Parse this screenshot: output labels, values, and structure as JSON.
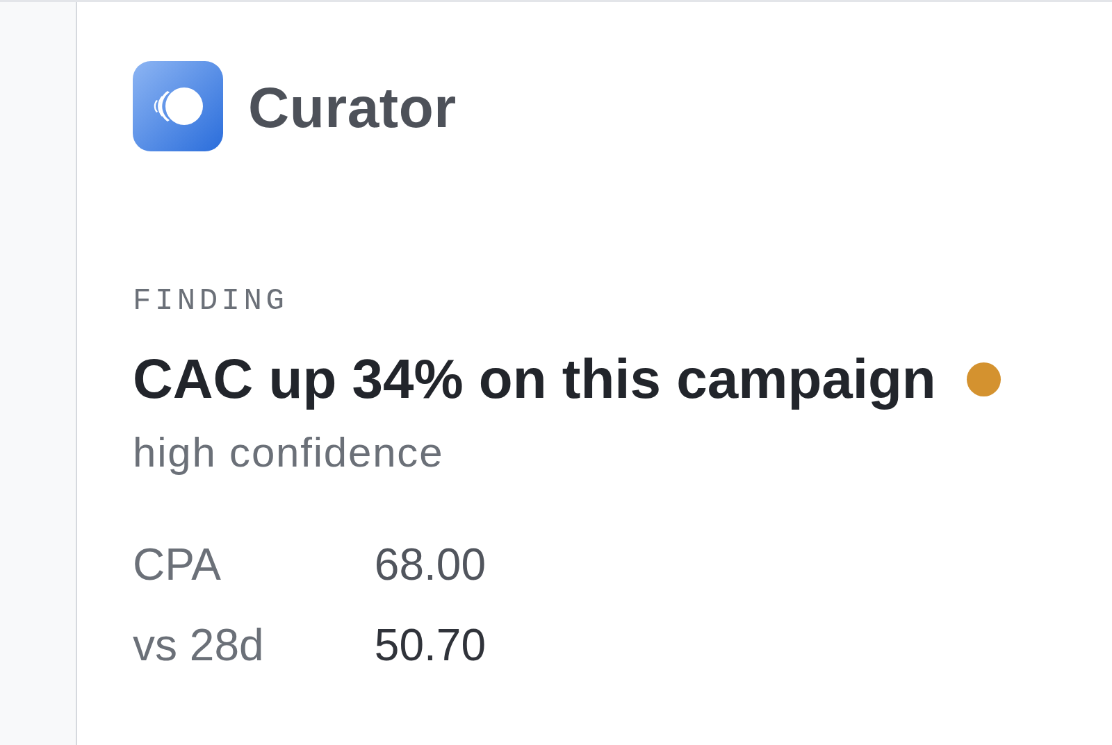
{
  "brand": {
    "name": "Curator"
  },
  "finding": {
    "eyebrow": "FINDING",
    "title": "CAC up 34% on this campaign",
    "color": "#d4922f",
    "confidence": "high confidence"
  },
  "metrics": [
    {
      "label": "CPA",
      "value": "68.00",
      "kind": "current"
    },
    {
      "label": "vs 28d",
      "value": "50.70",
      "kind": "baseline"
    }
  ]
}
